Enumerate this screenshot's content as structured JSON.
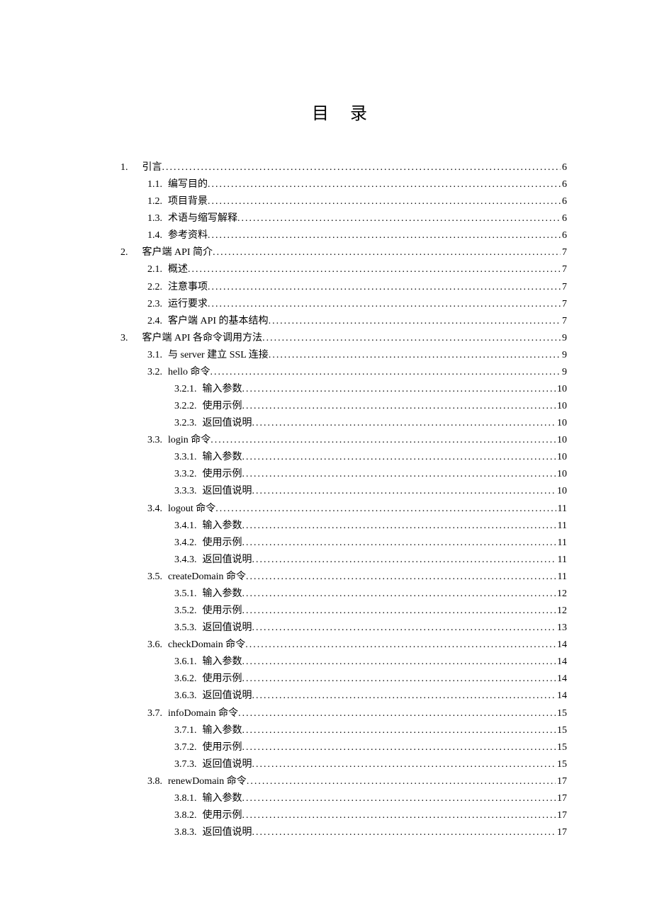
{
  "title": "目 录",
  "entries": [
    {
      "level": 1,
      "num": "1.",
      "title": "引言",
      "page": "6"
    },
    {
      "level": 2,
      "num": "1.1.",
      "title": "编写目的",
      "page": "6"
    },
    {
      "level": 2,
      "num": "1.2.",
      "title": "项目背景",
      "page": "6"
    },
    {
      "level": 2,
      "num": "1.3.",
      "title": "术语与缩写解释",
      "page": "6"
    },
    {
      "level": 2,
      "num": "1.4.",
      "title": "参考资料",
      "page": "6"
    },
    {
      "level": 1,
      "num": "2.",
      "title": "客户端 API 简介",
      "page": "7"
    },
    {
      "level": 2,
      "num": "2.1.",
      "title": "概述",
      "page": "7"
    },
    {
      "level": 2,
      "num": "2.2.",
      "title": "注意事项",
      "page": "7"
    },
    {
      "level": 2,
      "num": "2.3.",
      "title": "运行要求",
      "page": "7"
    },
    {
      "level": 2,
      "num": "2.4.",
      "title": "客户端 API 的基本结构",
      "page": "7"
    },
    {
      "level": 1,
      "num": "3.",
      "title": "客户端 API 各命令调用方法",
      "page": "9"
    },
    {
      "level": 2,
      "num": "3.1.",
      "title": "与 server 建立 SSL 连接",
      "page": "9"
    },
    {
      "level": 2,
      "num": "3.2.",
      "title": "hello 命令",
      "page": "9"
    },
    {
      "level": 3,
      "num": "3.2.1.",
      "title": "输入参数",
      "page": "10"
    },
    {
      "level": 3,
      "num": "3.2.2.",
      "title": "使用示例",
      "page": "10"
    },
    {
      "level": 3,
      "num": "3.2.3.",
      "title": "返回值说明",
      "page": "10"
    },
    {
      "level": 2,
      "num": "3.3.",
      "title": "login 命令",
      "page": "10"
    },
    {
      "level": 3,
      "num": "3.3.1.",
      "title": "输入参数",
      "page": "10"
    },
    {
      "level": 3,
      "num": "3.3.2.",
      "title": "使用示例",
      "page": "10"
    },
    {
      "level": 3,
      "num": "3.3.3.",
      "title": "返回值说明",
      "page": "10"
    },
    {
      "level": 2,
      "num": "3.4.",
      "title": "logout 命令",
      "page": "11"
    },
    {
      "level": 3,
      "num": "3.4.1.",
      "title": "输入参数",
      "page": "11"
    },
    {
      "level": 3,
      "num": "3.4.2.",
      "title": "使用示例",
      "page": "11"
    },
    {
      "level": 3,
      "num": "3.4.3.",
      "title": "返回值说明",
      "page": "11"
    },
    {
      "level": 2,
      "num": "3.5.",
      "title": "createDomain 命令",
      "page": "11"
    },
    {
      "level": 3,
      "num": "3.5.1.",
      "title": "输入参数",
      "page": "12"
    },
    {
      "level": 3,
      "num": "3.5.2.",
      "title": "使用示例",
      "page": "12"
    },
    {
      "level": 3,
      "num": "3.5.3.",
      "title": "返回值说明",
      "page": "13"
    },
    {
      "level": 2,
      "num": "3.6.",
      "title": "checkDomain 命令",
      "page": "14"
    },
    {
      "level": 3,
      "num": "3.6.1.",
      "title": "输入参数",
      "page": "14"
    },
    {
      "level": 3,
      "num": "3.6.2.",
      "title": "使用示例",
      "page": "14"
    },
    {
      "level": 3,
      "num": "3.6.3.",
      "title": "返回值说明",
      "page": "14"
    },
    {
      "level": 2,
      "num": "3.7.",
      "title": "infoDomain 命令",
      "page": "15"
    },
    {
      "level": 3,
      "num": "3.7.1.",
      "title": "输入参数",
      "page": "15"
    },
    {
      "level": 3,
      "num": "3.7.2.",
      "title": "使用示例",
      "page": "15"
    },
    {
      "level": 3,
      "num": "3.7.3.",
      "title": "返回值说明",
      "page": "15"
    },
    {
      "level": 2,
      "num": "3.8.",
      "title": "renewDomain 命令",
      "page": "17"
    },
    {
      "level": 3,
      "num": "3.8.1.",
      "title": "输入参数",
      "page": "17"
    },
    {
      "level": 3,
      "num": "3.8.2.",
      "title": "使用示例",
      "page": "17"
    },
    {
      "level": 3,
      "num": "3.8.3.",
      "title": "返回值说明",
      "page": "17"
    }
  ]
}
